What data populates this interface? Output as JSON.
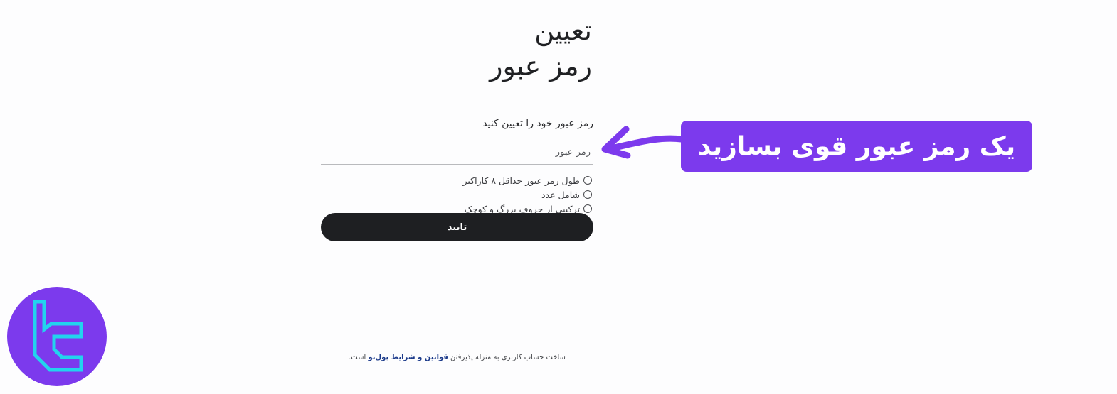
{
  "page": {
    "title_line1": "تعیین",
    "title_line2": "رمز عبور"
  },
  "form": {
    "instruction": "رمز عبور خود را تعیین کنید",
    "password_placeholder": "رمز عبور",
    "password_value": "",
    "rules": [
      {
        "label": "طول رمز عبور حداقل ۸ کاراکتر",
        "checked": false
      },
      {
        "label": "شامل عدد",
        "checked": false
      },
      {
        "label": "ترکیبی از حروف بزرگ و کوچک",
        "checked": false
      }
    ],
    "confirm_label": "تایید"
  },
  "annotation": {
    "callout_text": "یک رمز عبور قوی بسازید",
    "callout_color": "#7c3aed",
    "arrow_color": "#7c3aed"
  },
  "footer": {
    "prefix": "ساخت حساب کاربری به منزله پذیرفتن",
    "terms_link": "قوانین و شرایط پول‌نو",
    "suffix": "است."
  },
  "logo": {
    "icon": "tradingfinder-logo-icon",
    "background": "#7c3aed",
    "stroke": "#22d3ee"
  },
  "colors": {
    "button_bg": "#1e1f22",
    "button_text": "#ffffff",
    "link": "#1b3a8a"
  }
}
